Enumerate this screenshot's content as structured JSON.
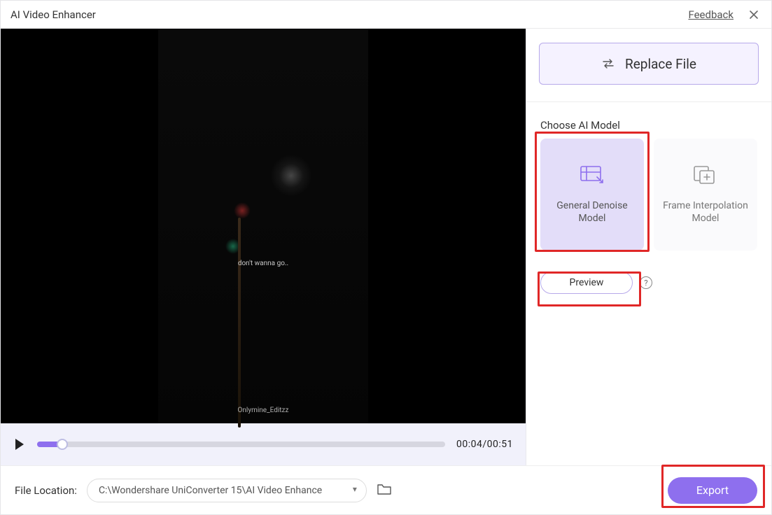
{
  "title": "AI Video Enhancer",
  "feedback_label": "Feedback",
  "video": {
    "caption1": "don't wanna go..",
    "watermark": "Onlymine_Editzz",
    "time_display": "00:04/00:51"
  },
  "sidebar": {
    "replace_label": "Replace File",
    "choose_label": "Choose AI Model",
    "models": {
      "denoise": "General Denoise Model",
      "interp": "Frame Interpolation Model"
    },
    "preview_label": "Preview"
  },
  "footer": {
    "file_location_label": "File Location:",
    "file_location_path": "C:\\Wondershare UniConverter 15\\AI Video Enhance",
    "export_label": "Export"
  }
}
